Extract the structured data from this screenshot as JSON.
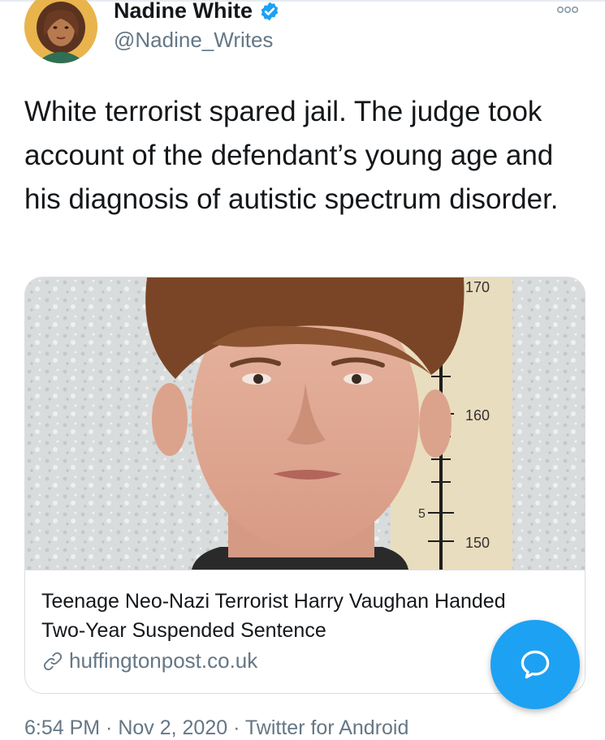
{
  "author": {
    "display_name": "Nadine White",
    "handle": "@Nadine_Writes",
    "verified": true
  },
  "tweet": {
    "text": "White terrorist spared jail. The judge took account of the defendant’s young age and his diagnosis of autistic spectrum disorder."
  },
  "card": {
    "title": "Teenage Neo-Nazi Terrorist Harry Vaughan Handed Two-Year Suspended Sentence",
    "domain": "huffingtonpost.co.uk",
    "height_chart": {
      "label_170": "170",
      "label_160": "160",
      "label_150": "150",
      "label_5": "5"
    }
  },
  "meta": {
    "text": "6:54 PM · Nov 2, 2020 · Twitter for Android"
  },
  "icons": {
    "more": "more-options-icon",
    "verified": "verified-badge-icon",
    "link": "link-icon",
    "compose": "reply-compose-icon"
  },
  "colors": {
    "accent": "#1da1f2",
    "text": "#14171a",
    "secondary": "#657786"
  }
}
